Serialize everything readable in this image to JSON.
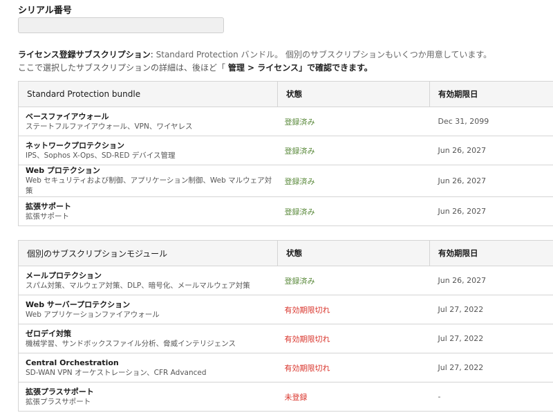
{
  "serial": {
    "label": "シリアル番号",
    "value": ""
  },
  "description": {
    "line1_bold": "ライセンス登録サブスクリプション",
    "line1_colon": ": ",
    "line1_light": "Standard Protection バンドル。",
    "line1_rest": " 個別のサブスクリプションもいくつか用意しています。",
    "line2_a": "ここで選択したサブスクリプションの詳細は、後ほど「 ",
    "line2_bold": "管理 > ライセンス",
    "line2_b": "」で確認できます。"
  },
  "bundle_table": {
    "headers": [
      "Standard Protection bundle",
      "状態",
      "有効期限日"
    ],
    "rows": [
      {
        "name": "ベースファイアウォール",
        "desc": "ステートフルファイアウォール、VPN、ワイヤレス",
        "status": "登録済み",
        "status_type": "ok",
        "expiry": "Dec 31, 2099"
      },
      {
        "name": "ネットワークプロテクション",
        "desc": "IPS、Sophos X-Ops、SD-RED デバイス管理",
        "status": "登録済み",
        "status_type": "ok",
        "expiry": "Jun 26, 2027"
      },
      {
        "name": "Web プロテクション",
        "desc": "Web セキュリティおよび制御、アプリケーション制御、Web マルウェア対策",
        "status": "登録済み",
        "status_type": "ok",
        "expiry": "Jun 26, 2027"
      },
      {
        "name": "拡張サポート",
        "desc": "拡張サポート",
        "status": "登録済み",
        "status_type": "ok",
        "expiry": "Jun 26, 2027"
      }
    ]
  },
  "module_table": {
    "headers": [
      "個別のサブスクリプションモジュール",
      "状態",
      "有効期限日"
    ],
    "rows": [
      {
        "name": "メールプロテクション",
        "desc": "スパム対策、マルウェア対策、DLP、暗号化、メールマルウェア対策",
        "status": "登録済み",
        "status_type": "ok",
        "expiry": "Jun 26, 2027"
      },
      {
        "name": "Web サーバープロテクション",
        "desc": "Web アプリケーションファイアウォール",
        "status": "有効期限切れ",
        "status_type": "expired",
        "expiry": "Jul 27, 2022"
      },
      {
        "name": "ゼロデイ対策",
        "desc": "機械学習、サンドボックスファイル分析、脅威インテリジェンス",
        "status": "有効期限切れ",
        "status_type": "expired",
        "expiry": "Jul 27, 2022"
      },
      {
        "name": "Central Orchestration",
        "desc": "SD-WAN VPN オーケストレーション、CFR Advanced",
        "status": "有効期限切れ",
        "status_type": "expired",
        "expiry": "Jul 27, 2022"
      },
      {
        "name": "拡張プラスサポート",
        "desc": "拡張プラスサポート",
        "status": "未登録",
        "status_type": "expired",
        "expiry": "-"
      }
    ]
  },
  "colors": {
    "ok": "#5b8a3c",
    "expired": "#d9342b",
    "header_bg": "#f5f5f5",
    "border": "#d4d4d4"
  }
}
